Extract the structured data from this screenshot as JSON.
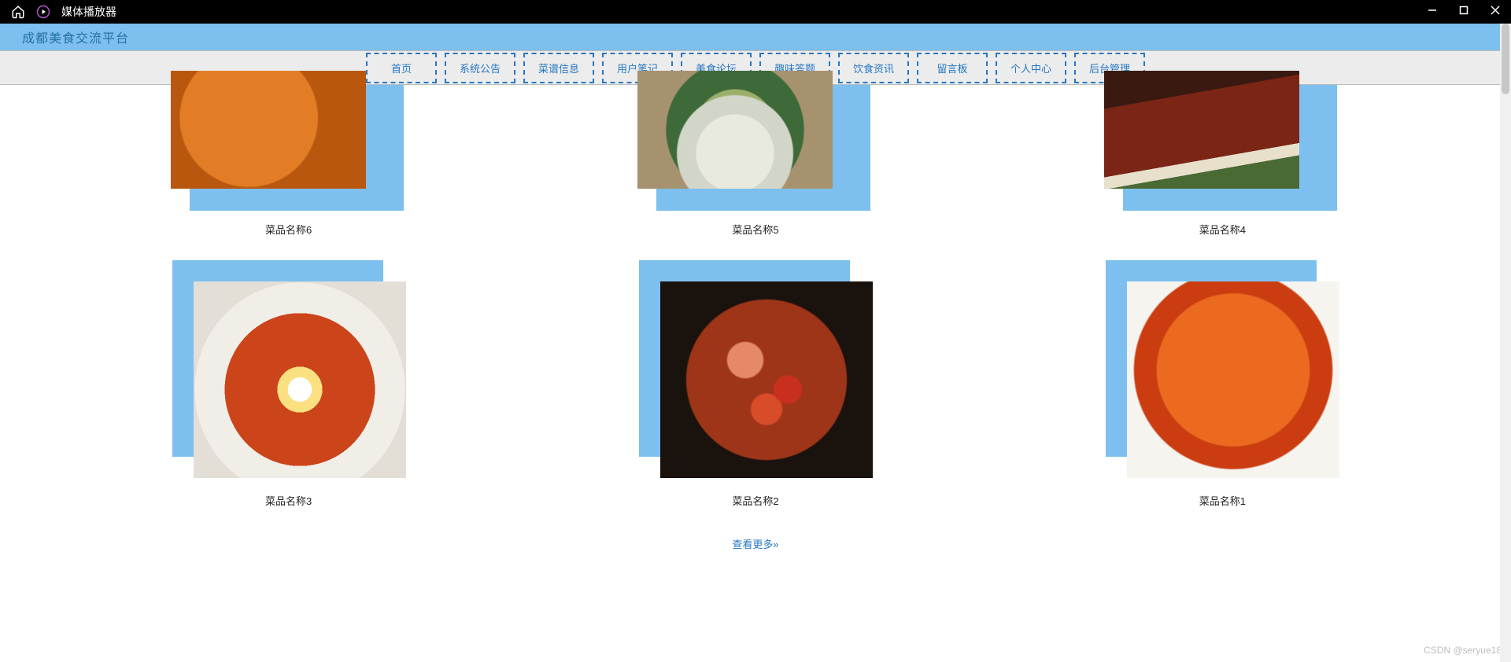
{
  "titlebar": {
    "appName": "媒体播放器"
  },
  "siteHeader": {
    "title": "成都美食交流平台"
  },
  "nav": {
    "items": [
      {
        "label": "首页"
      },
      {
        "label": "系统公告"
      },
      {
        "label": "菜谱信息"
      },
      {
        "label": "用户笔记"
      },
      {
        "label": "美食论坛"
      },
      {
        "label": "趣味答题"
      },
      {
        "label": "饮食资讯"
      },
      {
        "label": "留言板"
      },
      {
        "label": "个人中心"
      },
      {
        "label": "后台管理"
      }
    ]
  },
  "dishes": {
    "row1": [
      {
        "title": "菜品名称6",
        "foodClass": "food6"
      },
      {
        "title": "菜品名称5",
        "foodClass": "food5"
      },
      {
        "title": "菜品名称4",
        "foodClass": "food4"
      }
    ],
    "row2": [
      {
        "title": "菜品名称3",
        "foodClass": "food3"
      },
      {
        "title": "菜品名称2",
        "foodClass": "food2"
      },
      {
        "title": "菜品名称1",
        "foodClass": "food1"
      }
    ]
  },
  "moreLink": {
    "label": "查看更多"
  },
  "watermark": {
    "text": "CSDN @seryue18"
  },
  "colors": {
    "accent": "#7dc0ef",
    "navBorder": "#2778c4"
  }
}
